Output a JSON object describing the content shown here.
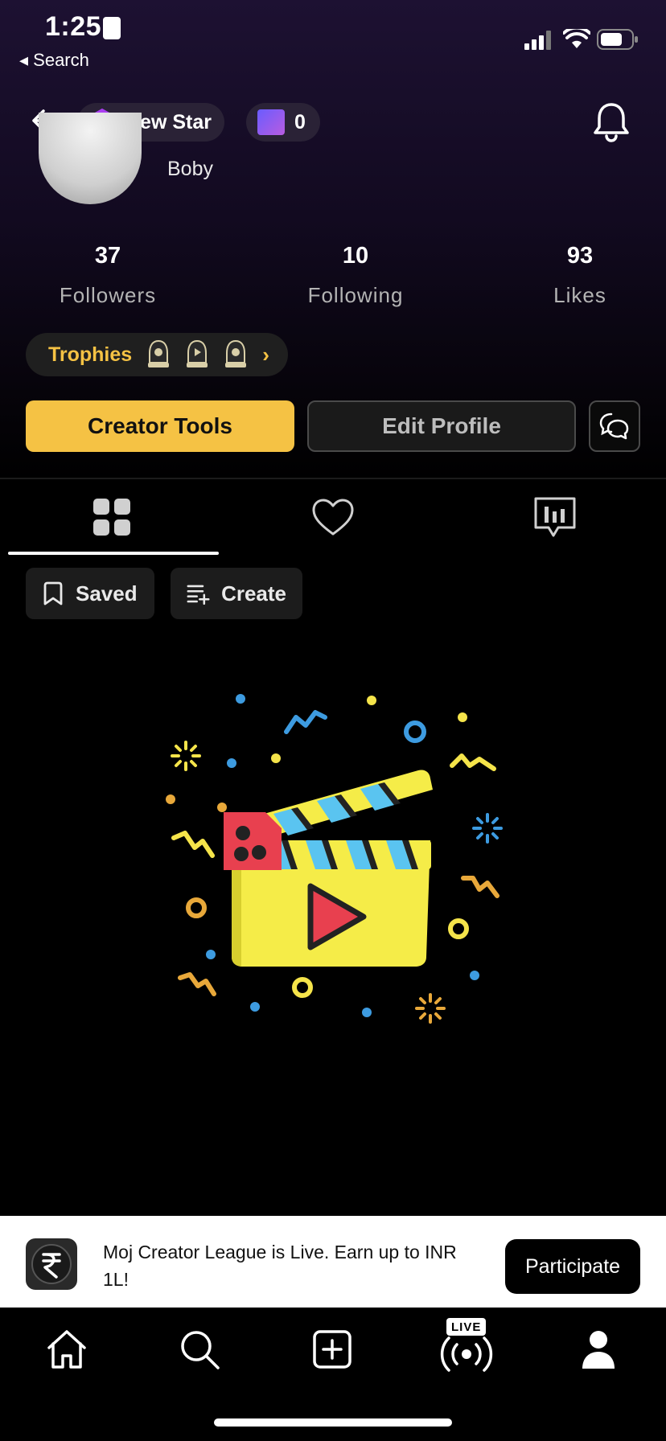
{
  "status_bar": {
    "time": "1:25",
    "back_app": "◂ Search"
  },
  "header": {
    "badge_label": "New Star",
    "coin_count": "0",
    "icons": [
      "back-arrow-icon",
      "gem-icon",
      "coin-box-icon",
      "bell-icon"
    ]
  },
  "profile": {
    "name": "Boby",
    "stats": [
      {
        "value": "37",
        "label": "Followers"
      },
      {
        "value": "10",
        "label": "Following"
      },
      {
        "value": "93",
        "label": "Likes"
      }
    ],
    "trophies_label": "Trophies",
    "trophies_chevron": "›"
  },
  "actions": {
    "creator_tools": "Creator Tools",
    "edit_profile": "Edit Profile"
  },
  "tabs": [
    "grid-icon",
    "heart-icon",
    "stats-icon"
  ],
  "filters": {
    "saved": "Saved",
    "create": "Create"
  },
  "banner": {
    "text": "Moj Creator League is Live. Earn up to INR 1L!",
    "button": "Participate"
  },
  "nav": {
    "live_label": "LIVE",
    "items": [
      "home-icon",
      "search-icon",
      "add-icon",
      "live-icon",
      "profile-icon"
    ]
  },
  "colors": {
    "accent": "#f5c244",
    "header_bg": "#1d1132"
  }
}
